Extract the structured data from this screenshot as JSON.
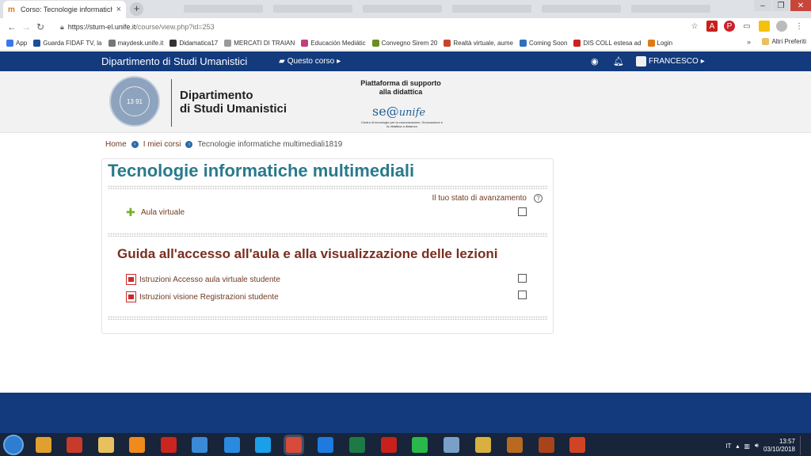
{
  "browser": {
    "tab_title": "Corso: Tecnologie informatiche m",
    "tab_favicon": "moodle-icon",
    "url_host": "https://stum-el.unife.it",
    "url_path": "/course/view.php?id=253",
    "bookmarks": [
      {
        "label": "App",
        "color": "#3b78e7"
      },
      {
        "label": "Guarda FIDAF TV, la",
        "color": "#1a4f9a"
      },
      {
        "label": "maydesk.unife.it",
        "color": "#777777"
      },
      {
        "label": "Didamatica17",
        "color": "#333333"
      },
      {
        "label": "MERCATI DI TRAIAN",
        "color": "#999999"
      },
      {
        "label": "Educación Mediátic",
        "color": "#c23e7a"
      },
      {
        "label": "Convegno Sirem 20",
        "color": "#6b8e23"
      },
      {
        "label": "Realtà virtuale, aume",
        "color": "#c8452c"
      },
      {
        "label": "Coming Soon",
        "color": "#2e6fbf"
      },
      {
        "label": "DIS COLL estesa ad",
        "color": "#c22"
      },
      {
        "label": "Login",
        "color": "#e07a10"
      }
    ],
    "bookmarks_more": "»",
    "other_bookmarks": "Altri Preferiti"
  },
  "navbar": {
    "brand": "Dipartimento di Studi Umanistici",
    "course_menu": "Questo corso",
    "user": "FRANCESCO"
  },
  "header": {
    "seal_text": "13 91",
    "dept_line1": "Dipartimento",
    "dept_line2": "di Studi Umanistici",
    "platform_line1": "Piattaforma di supporto",
    "platform_line2": "alla didattica",
    "sea_logo": "se@",
    "sea_logo_suffix": "unife",
    "sea_tagline": "Centro di tecnologie per la comunicazione, l'innovazione e la didattica a distanza"
  },
  "breadcrumb": {
    "home": "Home",
    "my_courses": "I miei corsi",
    "current": "Tecnologie informatiche multimediali1819"
  },
  "course": {
    "title": "Tecnologie informatiche multimediali",
    "progress_label": "Il tuo stato di avanzamento",
    "help": "?",
    "activity_virtual": "Aula virtuale",
    "section_title": "Guida all'accesso all'aula e alla visualizzazione delle lezioni",
    "resources": [
      "Istruzioni Accesso aula virtuale studente",
      "Istruzioni visione Registrazioni studente"
    ]
  },
  "taskbar": {
    "lang": "IT",
    "time": "13:57",
    "date": "03/10/2018",
    "apps": [
      {
        "name": "media-player-icon",
        "color": "#e0a030"
      },
      {
        "name": "tools-icon",
        "color": "#c83a2a"
      },
      {
        "name": "file-explorer-icon",
        "color": "#e8c060"
      },
      {
        "name": "vlc-icon",
        "color": "#f08a1c"
      },
      {
        "name": "filezilla-icon",
        "color": "#c8261e"
      },
      {
        "name": "vpn-icon",
        "color": "#3a8ad8"
      },
      {
        "name": "internet-explorer-icon",
        "color": "#2a8ae0"
      },
      {
        "name": "skype-icon",
        "color": "#1aa0e8"
      },
      {
        "name": "chrome-icon",
        "color": "#d84a3a"
      },
      {
        "name": "dropbox-icon",
        "color": "#1f7ae0"
      },
      {
        "name": "excel-icon",
        "color": "#1e7a44"
      },
      {
        "name": "acrobat-icon",
        "color": "#c8201a"
      },
      {
        "name": "whatsapp-icon",
        "color": "#2ab84a"
      },
      {
        "name": "scanner-icon",
        "color": "#7aa0c8"
      },
      {
        "name": "library-icon",
        "color": "#d8b040"
      },
      {
        "name": "game-icon",
        "color": "#b86a20"
      },
      {
        "name": "presentation-viewer-icon",
        "color": "#a8441a"
      },
      {
        "name": "powerpoint-icon",
        "color": "#d04424"
      }
    ]
  }
}
